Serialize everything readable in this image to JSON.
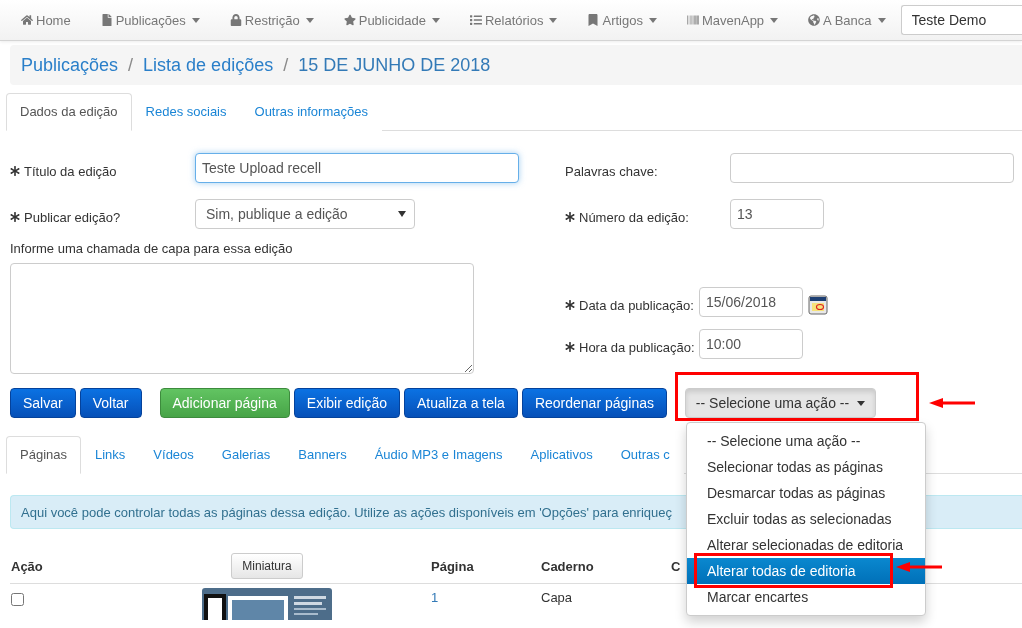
{
  "navbar": {
    "items": [
      {
        "label": "Home",
        "dropdown": false
      },
      {
        "label": "Publicações",
        "dropdown": true
      },
      {
        "label": "Restrição",
        "dropdown": true
      },
      {
        "label": "Publicidade",
        "dropdown": true
      },
      {
        "label": "Relatórios",
        "dropdown": true
      },
      {
        "label": "Artigos",
        "dropdown": true
      },
      {
        "label": "MavenApp",
        "dropdown": true
      },
      {
        "label": "A Banca",
        "dropdown": true
      }
    ],
    "search_value": "Teste Demo"
  },
  "breadcrumb": {
    "separator": "/",
    "items": [
      "Publicações",
      "Lista de edições",
      "15 DE JUNHO DE 2018"
    ]
  },
  "edition_tabs": [
    {
      "label": "Dados da edição",
      "selected": true
    },
    {
      "label": "Redes sociais",
      "selected": false
    },
    {
      "label": "Outras informações",
      "selected": false
    }
  ],
  "form": {
    "left": [
      {
        "kind": "text",
        "label": "Título da edição",
        "required": true,
        "value": "Teste Upload recell",
        "focused": true
      },
      {
        "kind": "select",
        "label": "Publicar edição?",
        "required": true,
        "value": "Sim, publique a edição"
      },
      {
        "kind": "textarea",
        "label": "Informe uma chamada de capa para essa edição",
        "required": false
      }
    ],
    "right": [
      {
        "kind": "text",
        "label": "Palavras chave:",
        "required": false
      },
      {
        "kind": "text",
        "label": "Número da edição:",
        "required": true,
        "value": "13"
      },
      {
        "kind": "date",
        "label": "Data da publicação:",
        "required": true,
        "value": "15/06/2018"
      },
      {
        "kind": "text",
        "label": "Hora da publicação:",
        "required": true,
        "value": "10:00"
      }
    ]
  },
  "buttons": [
    {
      "label": "Salvar",
      "kind": "primary"
    },
    {
      "label": "Voltar",
      "kind": "primary"
    },
    {
      "label": "Adicionar página",
      "kind": "success"
    },
    {
      "label": "Exibir edição",
      "kind": "primary"
    },
    {
      "label": "Atualiza a tela",
      "kind": "primary"
    },
    {
      "label": "Reordenar páginas",
      "kind": "primary"
    }
  ],
  "action_select": {
    "label": "-- Selecione uma ação --",
    "expanded": true,
    "highlighted": true,
    "options": [
      {
        "label": "-- Selecione uma ação --",
        "selected": false,
        "highlighted": false
      },
      {
        "label": "Selecionar todas as páginas",
        "selected": false,
        "highlighted": false
      },
      {
        "label": "Desmarcar todas as páginas",
        "selected": false,
        "highlighted": false
      },
      {
        "label": "Excluir todas as selecionadas",
        "selected": false,
        "highlighted": false
      },
      {
        "label": "Alterar selecionadas de editoria",
        "selected": false,
        "highlighted": false
      },
      {
        "label": "Alterar todas de editoria",
        "selected": true,
        "highlighted": true
      },
      {
        "label": "Marcar encartes",
        "selected": false,
        "highlighted": false
      }
    ]
  },
  "page_tabs": [
    {
      "label": "Páginas",
      "selected": true
    },
    {
      "label": "Links",
      "selected": false
    },
    {
      "label": "Vídeos",
      "selected": false
    },
    {
      "label": "Galerias",
      "selected": false
    },
    {
      "label": "Banners",
      "selected": false
    },
    {
      "label": "Áudio MP3 e Imagens",
      "selected": false
    },
    {
      "label": "Aplicativos",
      "selected": false
    },
    {
      "label": "Outras c",
      "selected": false
    }
  ],
  "alert": "Aqui você pode controlar todas as páginas dessa edição. Utilize as ações disponíveis em 'Opções' para enriqueç",
  "table": {
    "columns": [
      {
        "label": "Ação",
        "kind": "text"
      },
      {
        "label": "Miniatura",
        "kind": "button"
      },
      {
        "label": "Página",
        "kind": "text"
      },
      {
        "label": "Caderno",
        "kind": "text"
      },
      {
        "label": "C",
        "kind": "text"
      }
    ],
    "rows": [
      {
        "checked": false,
        "page": "1",
        "section": "Capa"
      }
    ]
  }
}
